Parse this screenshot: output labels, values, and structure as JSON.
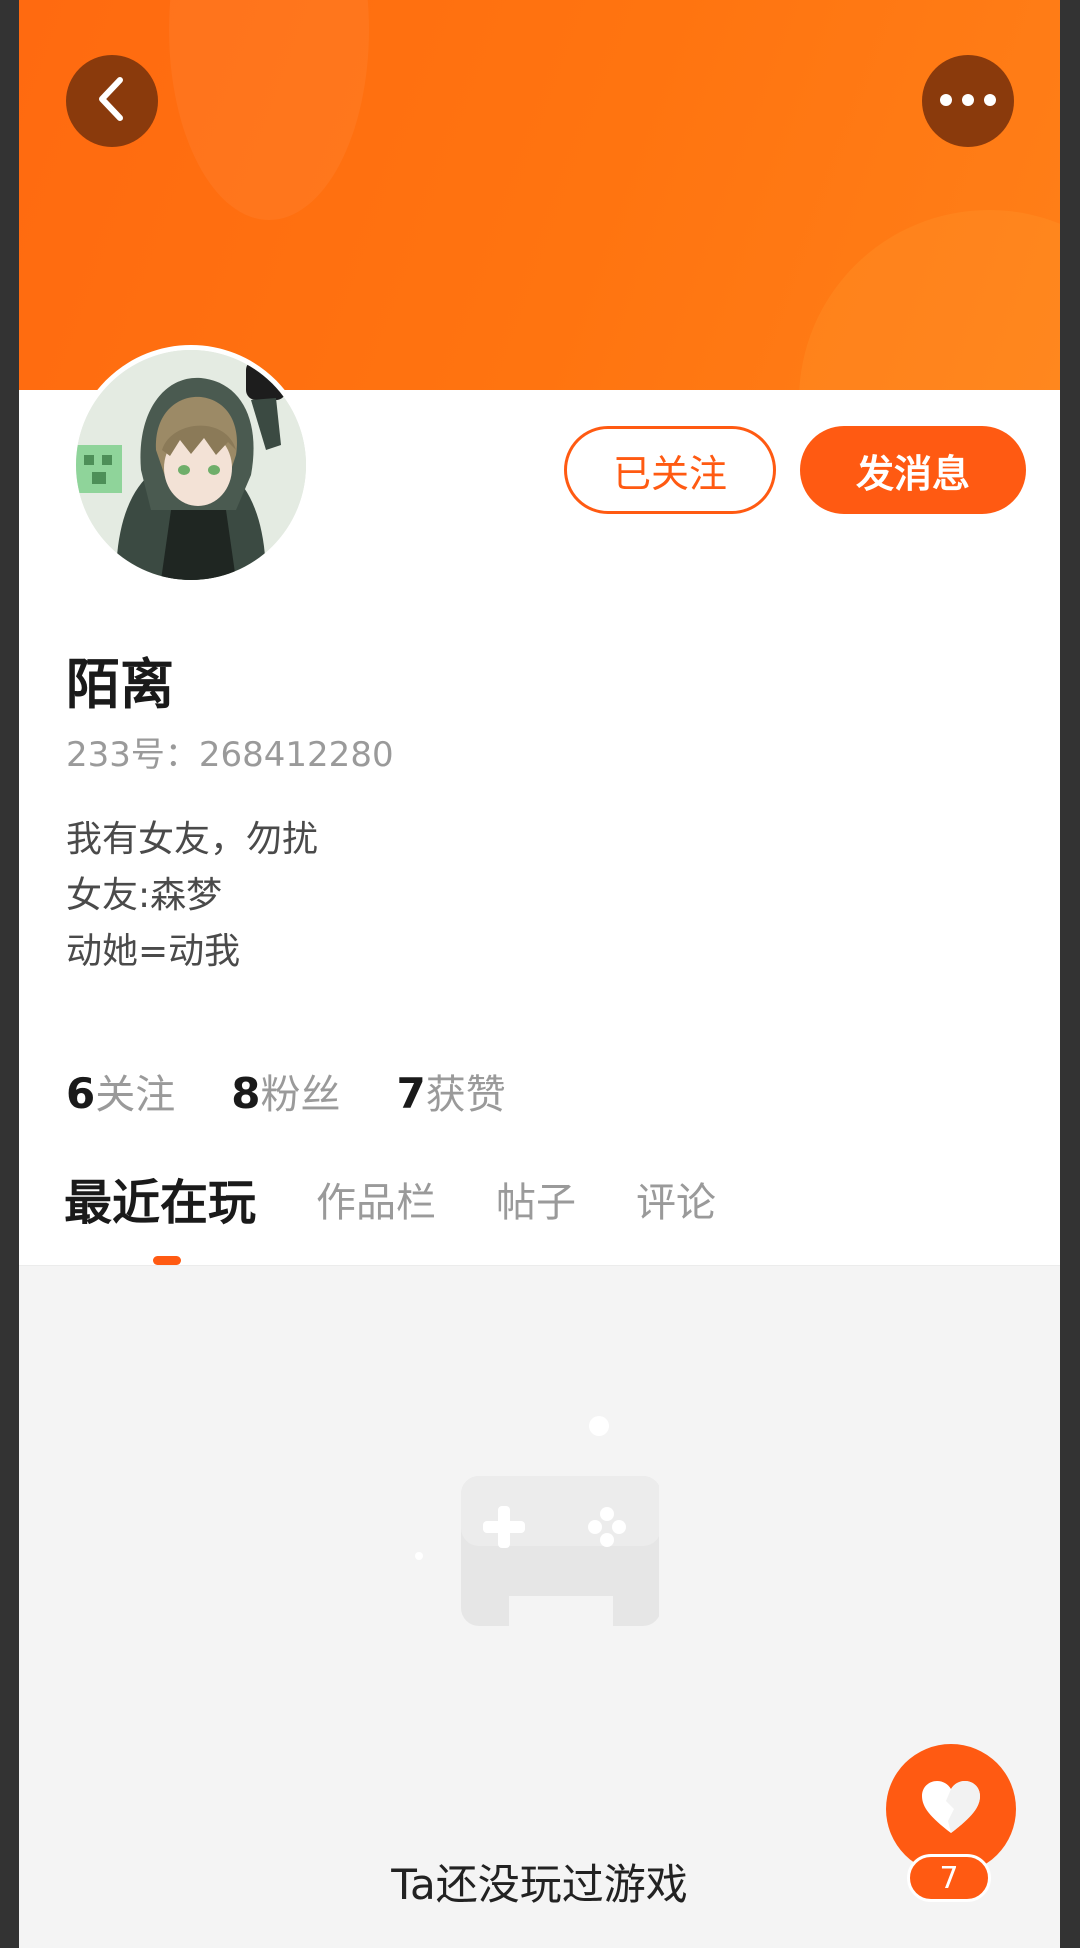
{
  "status_bar": {
    "left_fragment": "",
    "right_fragment": ""
  },
  "profile": {
    "name": "陌离",
    "uid_text": "233号：268412280",
    "bio_lines": [
      "我有女友，勿扰",
      "女友:森梦",
      "动她=动我"
    ]
  },
  "actions": {
    "follow_label": "已关注",
    "message_label": "发消息"
  },
  "stats": [
    {
      "value": "6",
      "label": "关注"
    },
    {
      "value": "8",
      "label": "粉丝"
    },
    {
      "value": "7",
      "label": "获赞"
    }
  ],
  "tabs": [
    {
      "label": "最近在玩",
      "active": true
    },
    {
      "label": "作品栏",
      "active": false
    },
    {
      "label": "帖子",
      "active": false
    },
    {
      "label": "评论",
      "active": false
    }
  ],
  "empty_state": {
    "text": "Ta还没玩过游戏",
    "icon": "gamepad-icon"
  },
  "like": {
    "count": "7",
    "icon": "heart-icon"
  },
  "colors": {
    "accent": "#ff5a12",
    "header": "#ff6a10",
    "muted": "#9a9a9a"
  },
  "icons": {
    "back": "chevron-left-icon",
    "more": "more-dots-icon"
  }
}
